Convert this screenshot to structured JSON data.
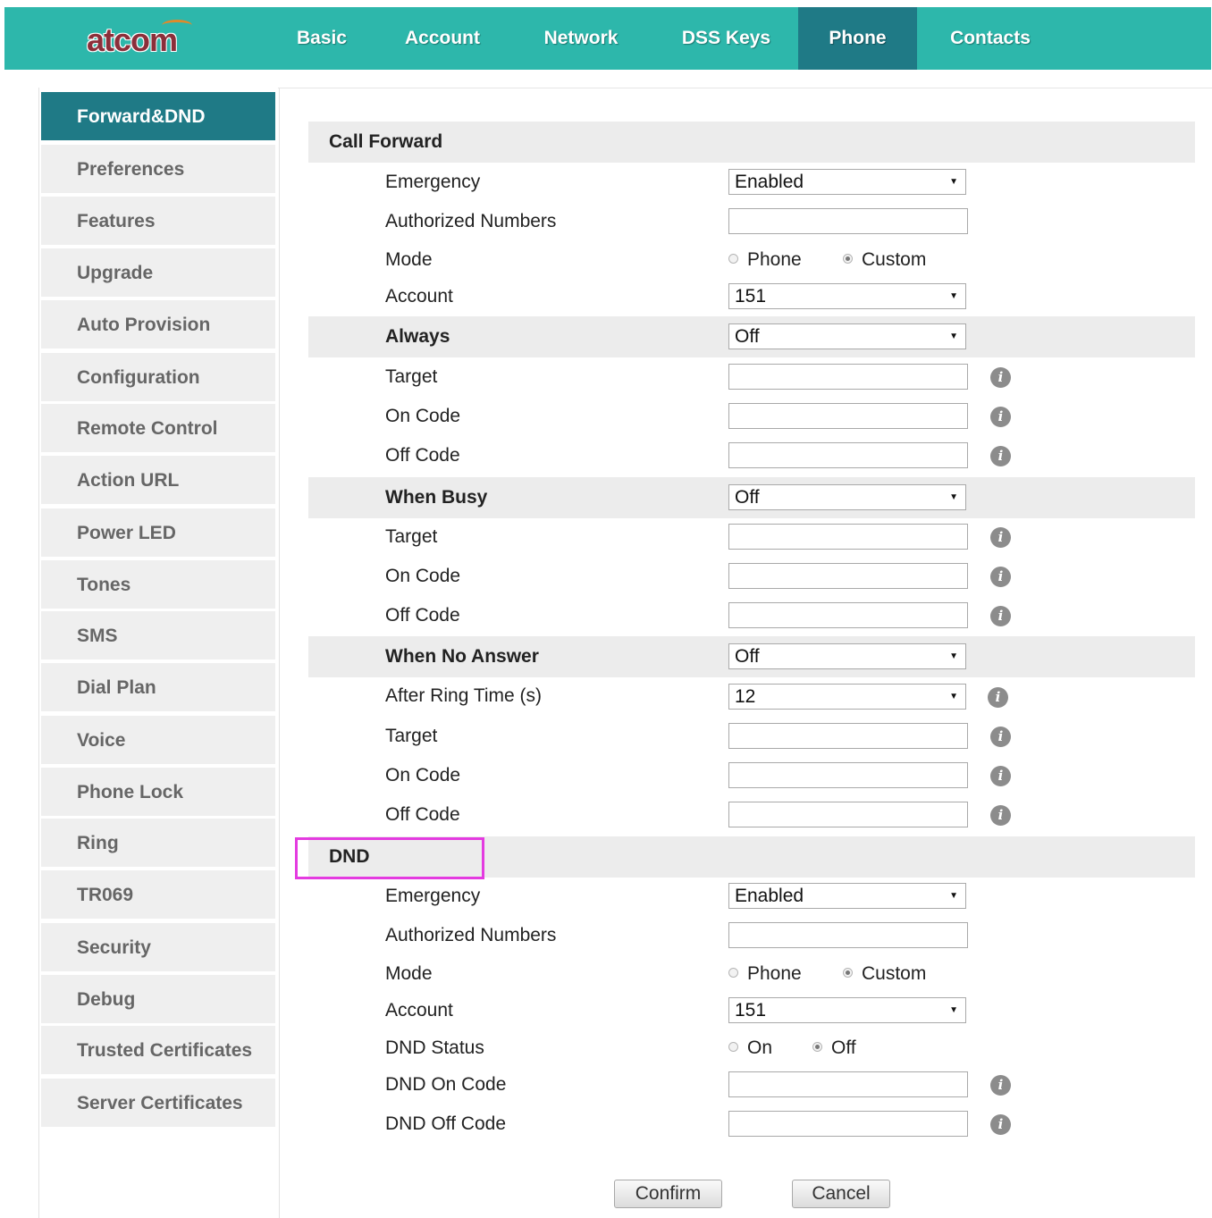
{
  "brand": {
    "logo_text": "atcom"
  },
  "nav": {
    "items": [
      "Basic",
      "Account",
      "Network",
      "DSS Keys",
      "Phone",
      "Contacts"
    ],
    "active": "Phone"
  },
  "sidebar": {
    "active": "Forward&DND",
    "items": [
      "Forward&DND",
      "Preferences",
      "Features",
      "Upgrade",
      "Auto Provision",
      "Configuration",
      "Remote Control",
      "Action URL",
      "Power LED",
      "Tones",
      "SMS",
      "Dial Plan",
      "Voice",
      "Phone Lock",
      "Ring",
      "TR069",
      "Security",
      "Debug",
      "Trusted Certificates",
      "Server Certificates"
    ]
  },
  "call_forward": {
    "title": "Call Forward",
    "emergency": {
      "label": "Emergency",
      "value": "Enabled"
    },
    "authorized_numbers": {
      "label": "Authorized Numbers",
      "value": ""
    },
    "mode": {
      "label": "Mode",
      "options": [
        "Phone",
        "Custom"
      ],
      "selected": "Custom"
    },
    "account": {
      "label": "Account",
      "value": "151"
    },
    "always": {
      "label": "Always",
      "value": "Off",
      "target_label": "Target",
      "on_code_label": "On Code",
      "off_code_label": "Off Code"
    },
    "when_busy": {
      "label": "When Busy",
      "value": "Off",
      "target_label": "Target",
      "on_code_label": "On Code",
      "off_code_label": "Off Code"
    },
    "when_no_answer": {
      "label": "When No Answer",
      "value": "Off",
      "ring_time_label": "After Ring Time (s)",
      "ring_time_value": "12",
      "target_label": "Target",
      "on_code_label": "On Code",
      "off_code_label": "Off Code"
    }
  },
  "dnd": {
    "title": "DND",
    "highlight_color": "#e43be0",
    "emergency": {
      "label": "Emergency",
      "value": "Enabled"
    },
    "authorized_numbers": {
      "label": "Authorized Numbers",
      "value": ""
    },
    "mode": {
      "label": "Mode",
      "options": [
        "Phone",
        "Custom"
      ],
      "selected": "Custom"
    },
    "account": {
      "label": "Account",
      "value": "151"
    },
    "status": {
      "label": "DND Status",
      "options": [
        "On",
        "Off"
      ],
      "selected": "Off"
    },
    "on_code_label": "DND On Code",
    "off_code_label": "DND Off Code"
  },
  "buttons": {
    "confirm": "Confirm",
    "cancel": "Cancel"
  },
  "icons": {
    "info": "info-icon",
    "dropdown": "chevron-down-icon",
    "info_glyph": "i",
    "arrow_glyph": "▼"
  },
  "colors": {
    "topbar": "#2db7ab",
    "active": "#1f7a86",
    "section": "#ececec"
  }
}
